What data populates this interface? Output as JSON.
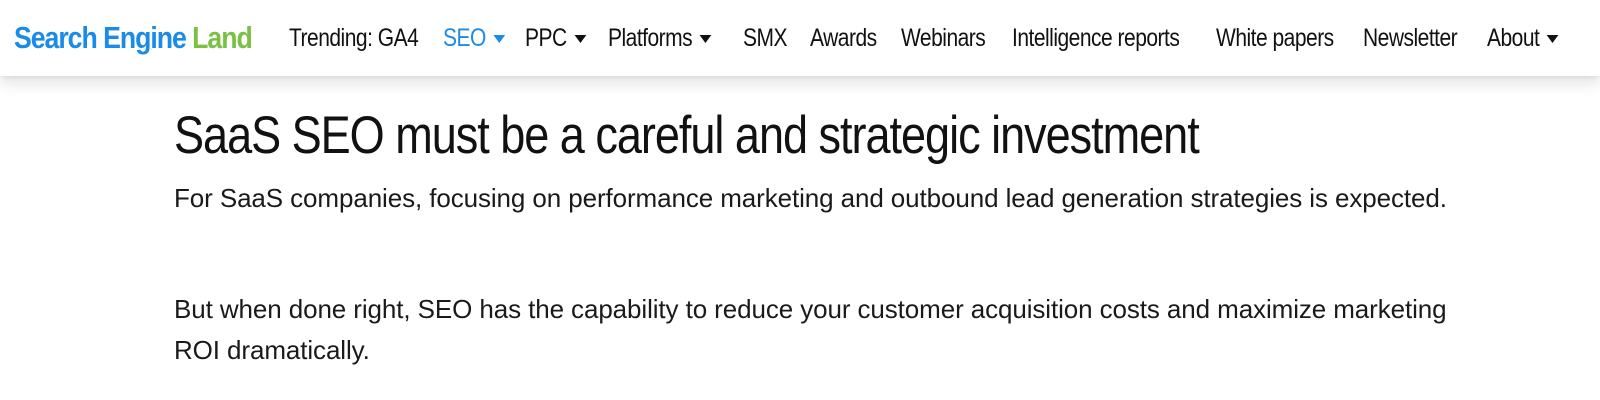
{
  "header": {
    "logo": {
      "part1": "Search Engine",
      "part2": "Land",
      "color_primary": "#1a8ce8",
      "color_secondary": "#7ac143"
    },
    "nav": [
      {
        "label": "Trending: GA4",
        "dropdown": false,
        "active": false
      },
      {
        "label": "SEO",
        "dropdown": true,
        "active": true
      },
      {
        "label": "PPC",
        "dropdown": true,
        "active": false
      },
      {
        "label": "Platforms",
        "dropdown": true,
        "active": false
      },
      {
        "label": "SMX",
        "dropdown": false,
        "active": false
      },
      {
        "label": "Awards",
        "dropdown": false,
        "active": false
      },
      {
        "label": "Webinars",
        "dropdown": false,
        "active": false
      },
      {
        "label": "Intelligence reports",
        "dropdown": false,
        "active": false
      },
      {
        "label": "White papers",
        "dropdown": false,
        "active": false
      },
      {
        "label": "Newsletter",
        "dropdown": false,
        "active": false
      },
      {
        "label": "About",
        "dropdown": true,
        "active": false
      }
    ],
    "active_color": "#1a8ce8",
    "dropdown_icon": "caret-down-icon"
  },
  "article": {
    "headline": "SaaS SEO must be a careful and strategic investment",
    "paragraphs": [
      "For SaaS companies, focusing on performance marketing and outbound lead generation strategies is expected.",
      "But when done right, SEO has the capability to reduce your customer acquisition costs and maximize marketing ROI dramatically."
    ]
  }
}
